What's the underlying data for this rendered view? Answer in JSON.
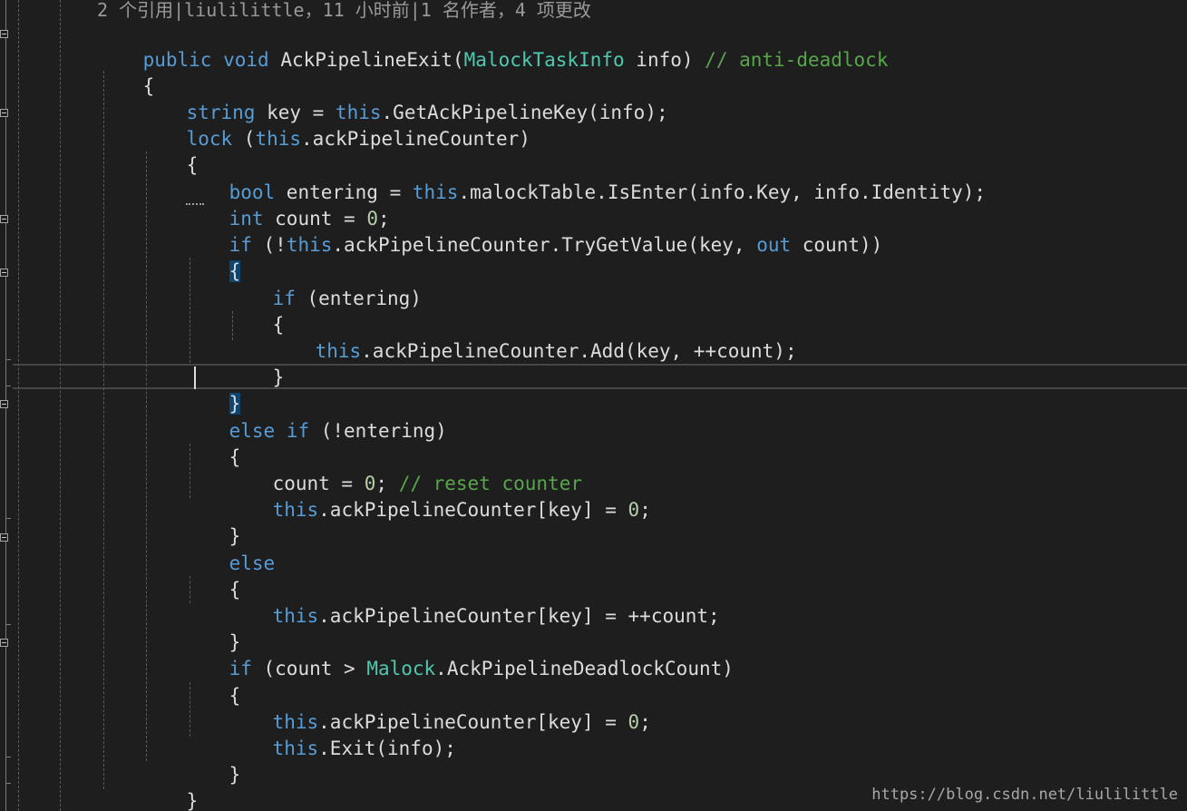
{
  "codelens": "2 个引用|liulilittle，11 小时前|1 名作者，4 项更改",
  "watermark": "https://blog.csdn.net/liulilittle",
  "tok": {
    "public": "public",
    "void": "void",
    "method_name": "AckPipelineExit",
    "lparen": "(",
    "param_type": "MalockTaskInfo",
    "param_rest": " info) ",
    "comment_deadlock": "// anti-deadlock",
    "lbrace": "{",
    "rbrace": "}",
    "string": "string",
    "key_assign": " key = ",
    "this": "this",
    "get_key_call": ".GetAckPipelineKey(info);",
    "lock": "lock",
    "lock_open": " (",
    "lock_rest": ".ackPipelineCounter)",
    "bool": "bool",
    "entering_assign": " entering = ",
    "is_enter_call": ".malockTable.IsEnter(info.Key, info.Identity);",
    "int": "int",
    "count_assign": " count = ",
    "zero": "0",
    "semicolon": ";",
    "if": "if",
    "not_open": " (!",
    "try_get": ".ackPipelineCounter.TryGetValue(key, ",
    "out": "out",
    "count_close": " count))",
    "entering_cond": " (entering)",
    "add_call": ".ackPipelineCounter.Add(key, ++count);",
    "else": "else",
    "else_if_sep": " ",
    "not_entering": " (!entering)",
    "count_reset": "count = ",
    "semicolon_space": "; ",
    "comment_reset": "// reset counter",
    "counter_index_assign": ".ackPipelineCounter[key] = ",
    "inc_count": "++count;",
    "count_gt": " (count > ",
    "malock": "Malock",
    "deadlock_count": ".AckPipelineDeadlockCount)",
    "exit_call": ".Exit(info);"
  },
  "colors": {
    "background": "#1e1e1e",
    "keyword": "#569cd6",
    "type": "#4ec9b0",
    "comment": "#57a64a",
    "number": "#b5cea8",
    "text": "#dcdcdc"
  }
}
